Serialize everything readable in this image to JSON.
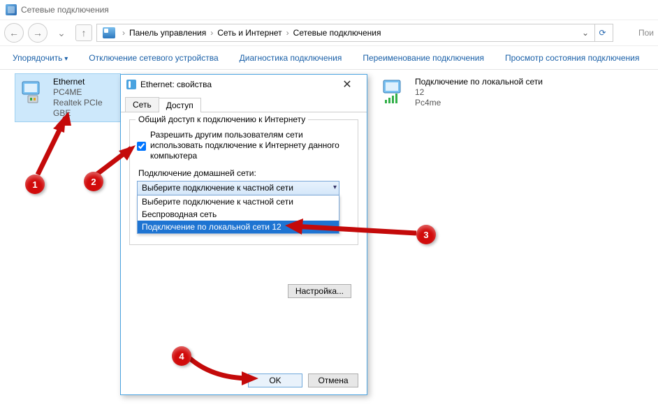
{
  "window": {
    "title": "Сетевые подключения"
  },
  "nav": {
    "crumb1": "Панель управления",
    "crumb2": "Сеть и Интернет",
    "crumb3": "Сетевые подключения",
    "searchHint": "Пои"
  },
  "cmd": {
    "organize": "Упорядочить",
    "disable": "Отключение сетевого устройства",
    "diagnose": "Диагностика подключения",
    "rename": "Переименование подключения",
    "status": "Просмотр состояния подключения"
  },
  "conn1": {
    "name": "Ethernet",
    "line2": "PC4ME",
    "line3": "Realtek PCIe GBE"
  },
  "conn2": {
    "name": "Подключение по локальной сети",
    "line2": "12",
    "line3": "Pc4me"
  },
  "dialog": {
    "title": "Ethernet: свойства",
    "tab1": "Сеть",
    "tab2": "Доступ",
    "groupTitle": "Общий доступ к подключению к Интернету",
    "chk1": "Разрешить другим пользователям сети использовать подключение к Интернету данного компьютера",
    "homeNetLabel": "Подключение домашней сети:",
    "comboValue": "Выберите подключение к частной сети",
    "opt1": "Выберите подключение к частной сети",
    "opt2": "Беспроводная сеть",
    "opt3": "Подключение по локальной сети 12",
    "settingsBtn": "Настройка...",
    "ok": "OK",
    "cancel": "Отмена"
  },
  "badges": {
    "b1": "1",
    "b2": "2",
    "b3": "3",
    "b4": "4"
  }
}
